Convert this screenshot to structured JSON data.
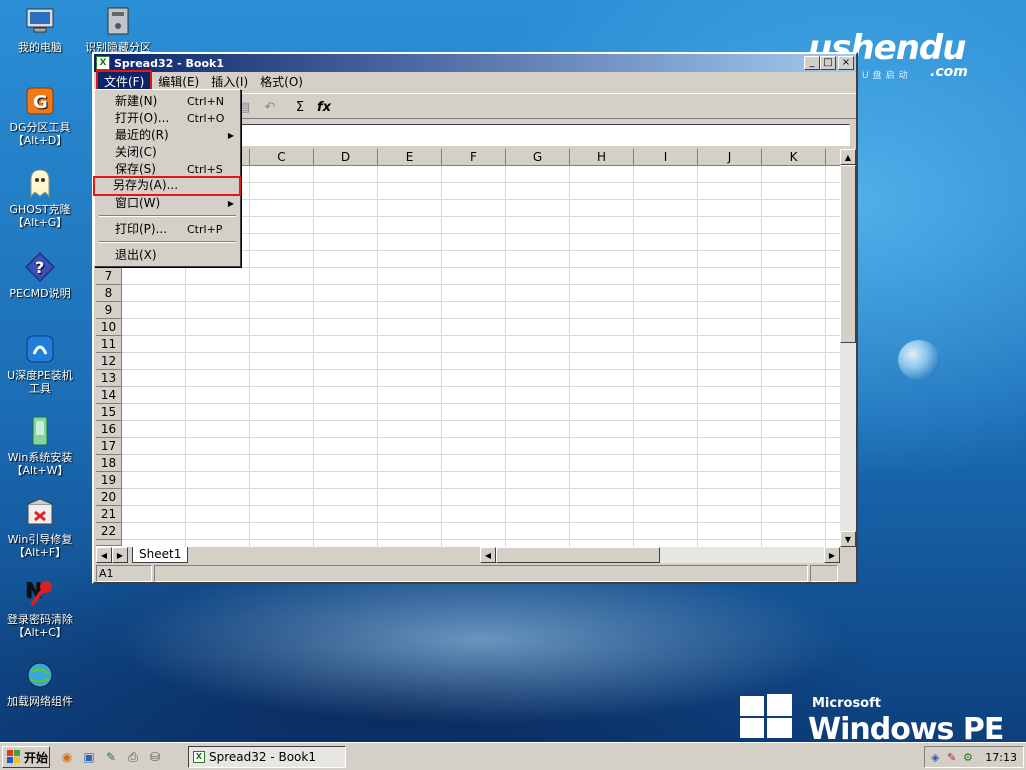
{
  "desktop": {
    "icons": [
      {
        "label": "我的电脑",
        "icon": "computer-icon"
      },
      {
        "label": "识别隐藏分区",
        "icon": "drive-icon"
      },
      {
        "label": "DG分区工具\n【Alt+D】",
        "icon": "diskgenius-icon"
      },
      {
        "label": "GHOST克隆\n【Alt+G】",
        "icon": "ghost-icon"
      },
      {
        "label": "PECMD说明",
        "icon": "help-icon"
      },
      {
        "label": "U深度PE装机\n工具",
        "icon": "installer-icon"
      },
      {
        "label": "Win系统安装\n【Alt+W】",
        "icon": "setup-icon"
      },
      {
        "label": "Win引导修复\n【Alt+F】",
        "icon": "repair-icon"
      },
      {
        "label": "登录密码清除\n【Alt+C】",
        "icon": "password-icon"
      },
      {
        "label": "加载网络组件",
        "icon": "network-icon"
      }
    ],
    "brand": {
      "name": "ushendu",
      "tagline": "深度U盘启动",
      "suffix": ".com"
    },
    "os_logo": {
      "vendor": "Microsoft",
      "name": "Windows PE"
    }
  },
  "window": {
    "title": "Spread32 - Book1",
    "menu": [
      "文件(F)",
      "编辑(E)",
      "插入(I)",
      "格式(O)"
    ],
    "active_menu": "文件(F)",
    "toolbar": {
      "sum_symbol": "Σ",
      "fx_symbol": "fx"
    },
    "columns": [
      "C",
      "D",
      "E",
      "F",
      "G",
      "H",
      "I",
      "J",
      "K"
    ],
    "rows": [
      "7",
      "8",
      "9",
      "10",
      "11",
      "12",
      "13",
      "14",
      "15",
      "16",
      "17",
      "18",
      "19",
      "20",
      "21",
      "22"
    ],
    "sheet_tab": "Sheet1",
    "status_cell": "A1"
  },
  "file_menu": {
    "items": [
      {
        "label": "新建(N)",
        "shortcut": "Ctrl+N"
      },
      {
        "label": "打开(O)...",
        "shortcut": "Ctrl+O"
      },
      {
        "label": "最近的(R)",
        "shortcut": "",
        "submenu": true
      },
      {
        "label": "关闭(C)",
        "shortcut": ""
      },
      {
        "label": "保存(S)",
        "shortcut": "Ctrl+S"
      },
      {
        "label": "另存为(A)...",
        "shortcut": "",
        "highlighted": true
      },
      {
        "label": "窗口(W)",
        "shortcut": "",
        "submenu": true
      },
      {
        "label": "打印(P)...",
        "shortcut": "Ctrl+P"
      },
      {
        "label": "退出(X)",
        "shortcut": ""
      }
    ]
  },
  "taskbar": {
    "start_label": "开始",
    "task_item": "Spread32 - Book1",
    "clock": "17:13"
  }
}
